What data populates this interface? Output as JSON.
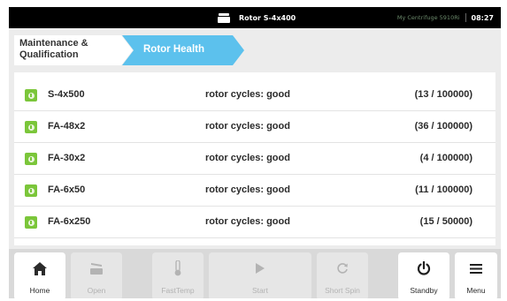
{
  "status_bar": {
    "title": "Rotor S-4x400",
    "device_name": "My Centrifuge 5910Ri",
    "clock": "08:27",
    "rotor_icon": "rotor-lid-icon"
  },
  "breadcrumb": {
    "parent": "Maintenance & Qualification",
    "current": "Rotor Health"
  },
  "rotors": [
    {
      "name": "S-4x500",
      "status": "rotor cycles: good",
      "cycles": "(13 / 100000)",
      "status_icon": "info-icon",
      "status_color": "#7bc63a"
    },
    {
      "name": "FA-48x2",
      "status": "rotor cycles: good",
      "cycles": "(36 / 100000)",
      "status_icon": "info-icon",
      "status_color": "#7bc63a"
    },
    {
      "name": "FA-30x2",
      "status": "rotor cycles: good",
      "cycles": "(4 / 100000)",
      "status_icon": "info-icon",
      "status_color": "#7bc63a"
    },
    {
      "name": "FA-6x50",
      "status": "rotor cycles: good",
      "cycles": "(11 / 100000)",
      "status_icon": "info-icon",
      "status_color": "#7bc63a"
    },
    {
      "name": "FA-6x250",
      "status": "rotor cycles: good",
      "cycles": "(15 / 50000)",
      "status_icon": "info-icon",
      "status_color": "#7bc63a"
    }
  ],
  "nav": {
    "home": {
      "label": "Home",
      "icon": "home-icon"
    },
    "open": {
      "label": "Open",
      "icon": "lid-open-icon"
    },
    "fasttemp": {
      "label": "FastTemp",
      "icon": "thermometer-icon"
    },
    "start": {
      "label": "Start",
      "icon": "play-icon"
    },
    "short_spin": {
      "label": "Short Spin",
      "icon": "refresh-icon"
    },
    "standby": {
      "label": "Standby",
      "icon": "power-icon"
    },
    "menu": {
      "label": "Menu",
      "icon": "hamburger-menu-icon"
    }
  },
  "colors": {
    "accent": "#5cc1ed",
    "good": "#7bc63a",
    "status_bar": "#000000"
  }
}
